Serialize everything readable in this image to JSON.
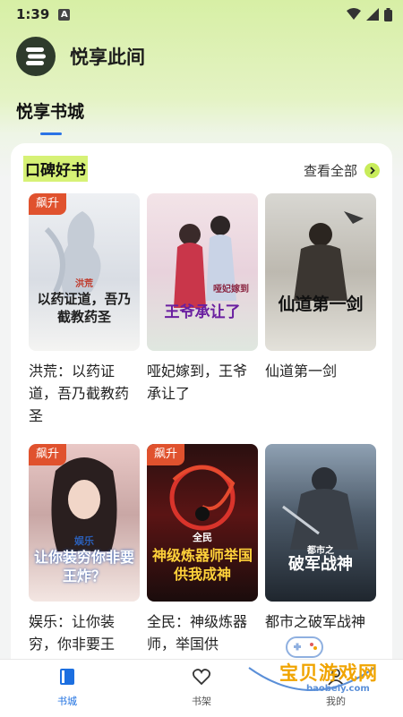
{
  "status": {
    "time": "1:39",
    "notif_letter": "A"
  },
  "app": {
    "title": "悦享此间"
  },
  "top_tabs": [
    {
      "label": "悦享书城"
    }
  ],
  "section": {
    "title": "口碑好书",
    "see_all": "查看全部"
  },
  "books": [
    {
      "name": "洪荒：以药证道，吾乃截教药圣",
      "badge": "飙升",
      "cover_text": "以药证道，吾乃截教药圣",
      "cover_tag": "洪荒"
    },
    {
      "name": "哑妃嫁到，王爷承让了",
      "badge": "",
      "cover_text": "王爷承让了",
      "cover_tag": "哑妃嫁到"
    },
    {
      "name": "仙道第一剑",
      "badge": "",
      "cover_text": "仙道第一剑",
      "cover_tag": ""
    },
    {
      "name": "娱乐：让你装穷，你非要王",
      "badge": "飙升",
      "cover_text": "让你装穷你非要王炸？",
      "cover_tag": "娱乐"
    },
    {
      "name": "全民：神级炼器师，举国供",
      "badge": "飙升",
      "cover_text": "神级炼器师举国供我成神",
      "cover_tag": "全民"
    },
    {
      "name": "都市之破军战神",
      "badge": "",
      "cover_text": "破军战神",
      "cover_tag": "都市之"
    }
  ],
  "bottom_nav": [
    {
      "label": "书城",
      "icon": "book-icon",
      "active": true
    },
    {
      "label": "书架",
      "icon": "heart-icon",
      "active": false
    },
    {
      "label": "我的",
      "icon": "person-icon",
      "active": false
    }
  ],
  "watermark": {
    "text": "宝贝游戏网",
    "url": "baobeiy.com"
  },
  "colors": {
    "accent": "#2b74e6",
    "badge": "#e0522e",
    "highlight": "#d6f176"
  }
}
